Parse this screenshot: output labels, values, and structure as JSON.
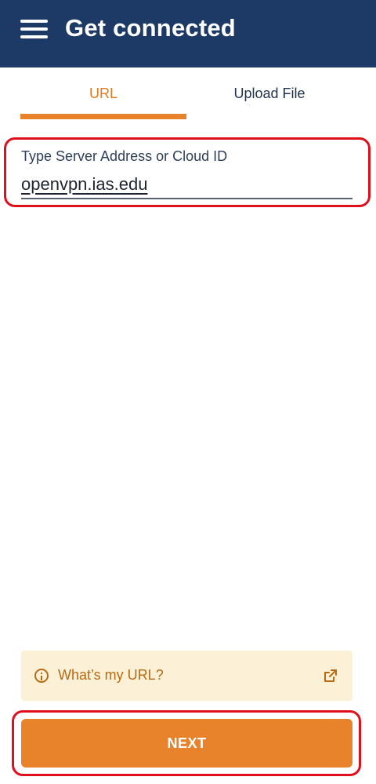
{
  "header": {
    "title": "Get connected",
    "menu_icon": "hamburger-menu-icon",
    "background_color": "#1d3966"
  },
  "tabs": [
    {
      "label": "URL",
      "active": true
    },
    {
      "label": "Upload File",
      "active": false
    }
  ],
  "server_field": {
    "label": "Type Server Address or Cloud ID",
    "value": "openvpn.ias.edu"
  },
  "help_link": {
    "label": "What’s my URL?",
    "icon": "info-icon",
    "trailing_icon": "external-link-icon"
  },
  "next_button": {
    "label": "NEXT",
    "color": "#e8822b"
  },
  "accent_color": "#e8822b",
  "highlight_color": "#e00f1c"
}
